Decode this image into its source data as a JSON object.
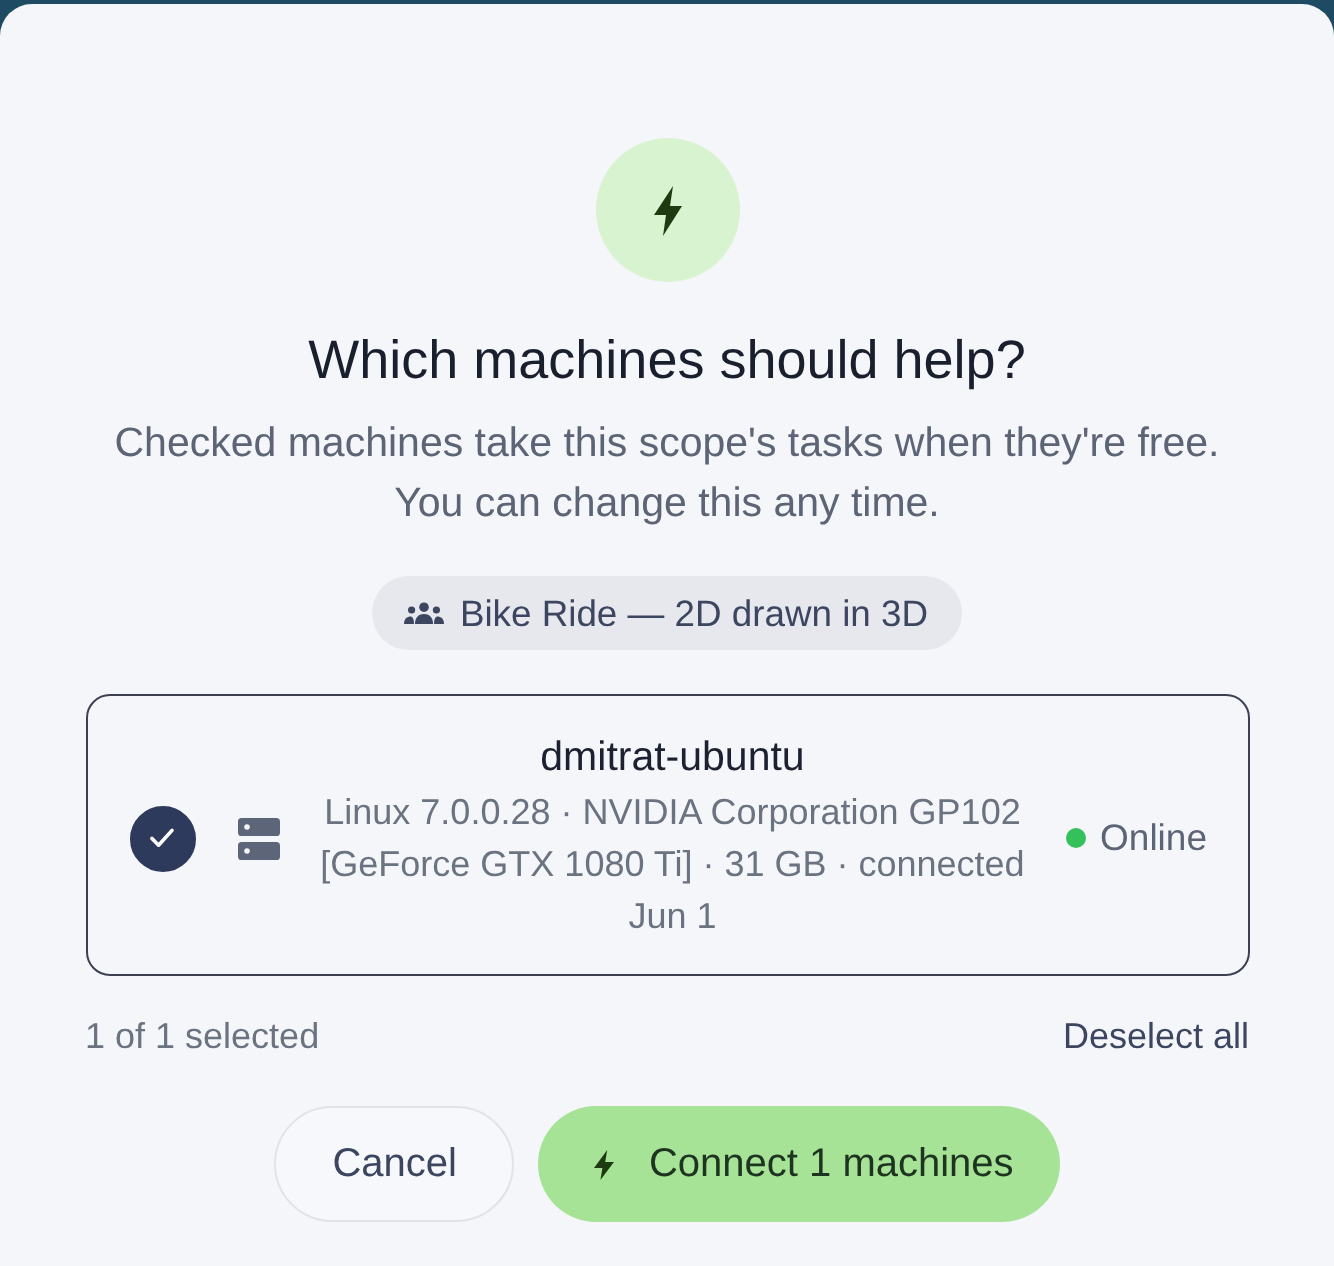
{
  "dialog": {
    "title": "Which machines should help?",
    "subtitle": "Checked machines take this scope's tasks when they're free. You can change this any time."
  },
  "scope": {
    "label": "Bike Ride — 2D drawn in 3D"
  },
  "machines": [
    {
      "name": "dmitrat-ubuntu",
      "details": "Linux 7.0.0.28 · NVIDIA Corporation GP102 [GeForce GTX 1080 Ti] · 31 GB · connected Jun 1",
      "status": "Online",
      "color": "#34c05a",
      "selected": true
    }
  ],
  "footer": {
    "selection_count": "1 of 1 selected",
    "deselect_all": "Deselect all"
  },
  "buttons": [
    {
      "label": "Cancel",
      "kind": "secondary"
    },
    {
      "label": "Connect 1 machines",
      "kind": "primary"
    }
  ]
}
